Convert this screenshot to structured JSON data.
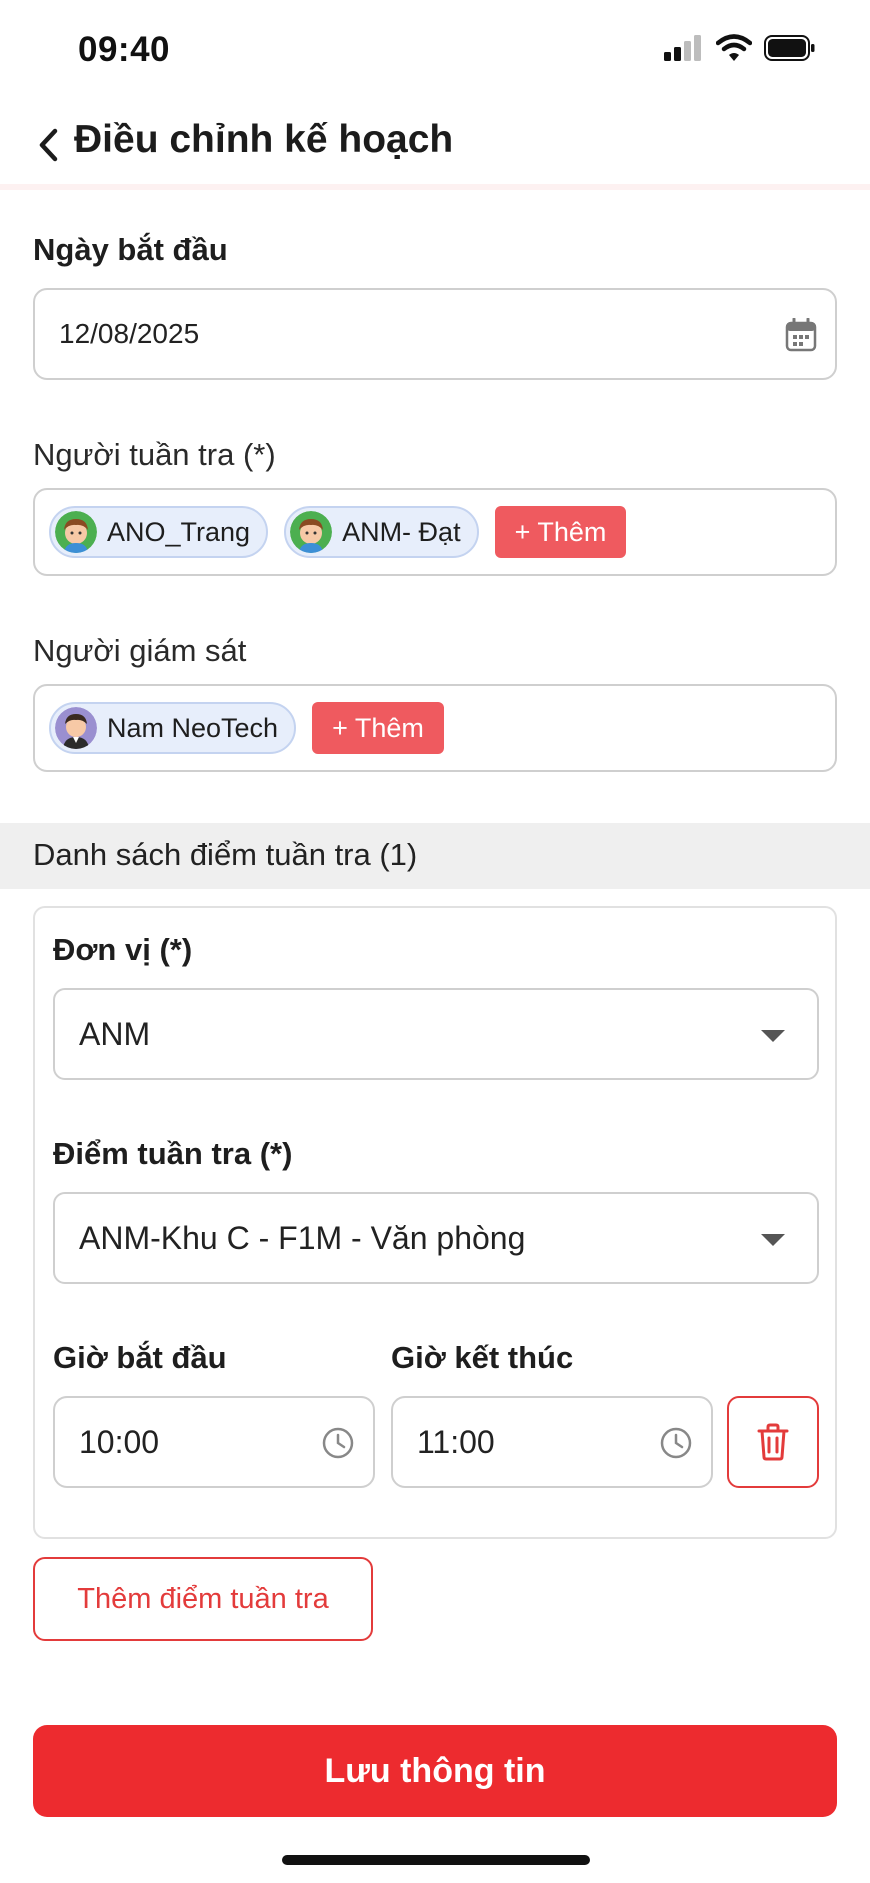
{
  "status_bar": {
    "time": "09:40",
    "icons": [
      "cellular-signal-icon",
      "wifi-icon",
      "battery-icon"
    ]
  },
  "header": {
    "back_icon": "chevron-left-icon",
    "title": "Điều chỉnh kế hoạch"
  },
  "start_date": {
    "label": "Ngày bắt đầu",
    "value": "12/08/2025",
    "icon": "calendar-icon"
  },
  "patrollers": {
    "label": "Người tuần tra (*)",
    "people": [
      {
        "name": "ANO_Trang",
        "avatar": "avatar-icon"
      },
      {
        "name": "ANM- Đạt",
        "avatar": "avatar-icon"
      }
    ],
    "add_label": "+ Thêm"
  },
  "supervisors": {
    "label": "Người giám sát",
    "people": [
      {
        "name": "Nam NeoTech",
        "avatar": "avatar-icon"
      }
    ],
    "add_label": "+ Thêm"
  },
  "checkpoints": {
    "title": "Danh sách điểm tuần tra (1)",
    "items": [
      {
        "unit_label": "Đơn vị (*)",
        "unit_value": "ANM",
        "point_label": "Điểm tuần tra (*)",
        "point_value": "ANM-Khu C - F1M - Văn phòng",
        "start_label": "Giờ bắt đầu",
        "start_value": "10:00",
        "end_label": "Giờ kết thúc",
        "end_value": "11:00",
        "delete_icon": "trash-icon"
      }
    ],
    "add_button": "Thêm điểm tuần tra"
  },
  "save_button": "Lưu thông tin",
  "colors": {
    "primary": "#ed2b2f",
    "chip_add": "#ef5a5f",
    "chip_bg": "#e7eefb",
    "section_band": "#efefef"
  }
}
